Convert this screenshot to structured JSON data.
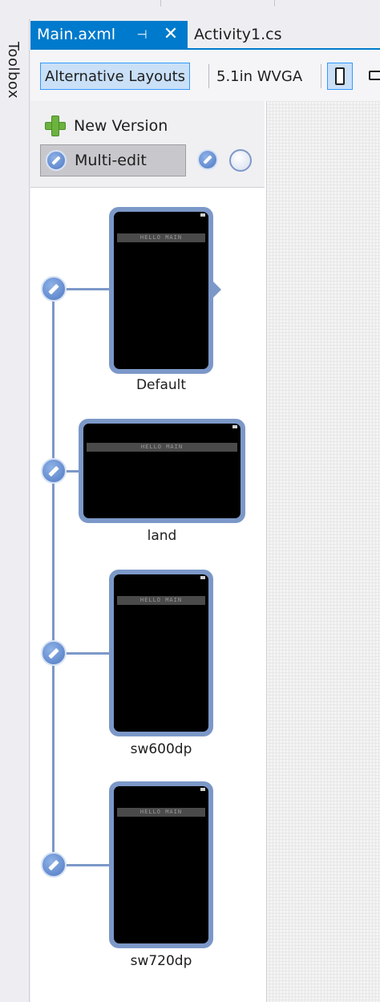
{
  "toolbox": {
    "label": "Toolbox"
  },
  "tabs": {
    "active": {
      "label": "Main.axml",
      "pin_icon": "pin-icon",
      "close_icon": "close-icon"
    },
    "inactive": {
      "label": "Activity1.cs"
    }
  },
  "toolbar": {
    "alternative_layouts": "Alternative Layouts",
    "device": "5.1in WVGA",
    "orientation_portrait_icon": "portrait-phone-icon",
    "orientation_landscape_icon": "landscape-phone-icon"
  },
  "panel": {
    "new_version": "New Version",
    "multi_edit": "Multi-edit",
    "versions": [
      {
        "label": "Default",
        "orientation": "portrait",
        "actionbar": "HELLO MAIN"
      },
      {
        "label": "land",
        "orientation": "landscape",
        "actionbar": "HELLO MAIN"
      },
      {
        "label": "sw600dp",
        "orientation": "portrait",
        "actionbar": "HELLO MAIN"
      },
      {
        "label": "sw720dp",
        "orientation": "portrait",
        "actionbar": "HELLO MAIN"
      }
    ]
  },
  "colors": {
    "accent": "#007acc",
    "device_frame": "#7c98c8",
    "toggle_selected": "#c9e0f7"
  }
}
